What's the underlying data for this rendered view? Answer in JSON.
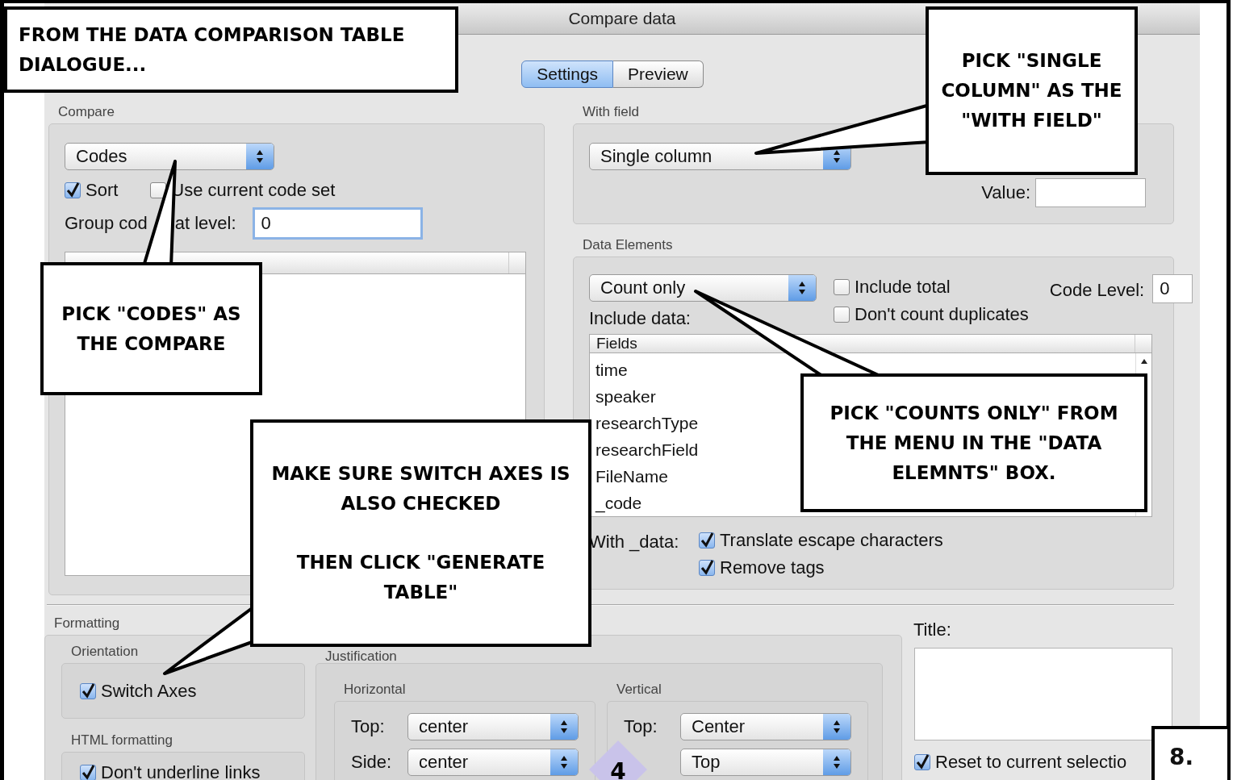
{
  "window": {
    "title": "Compare data"
  },
  "tabs": [
    {
      "label": "Settings",
      "selected": true
    },
    {
      "label": "Preview",
      "selected": false
    }
  ],
  "compare": {
    "title": "Compare",
    "menu": "Codes",
    "options": [
      {
        "label": "Sort",
        "checked": true
      },
      {
        "label": "Use current code set",
        "checked": false
      }
    ],
    "group_label_parts": [
      "Group cod",
      "at level:"
    ],
    "group_level": "0"
  },
  "with_field": {
    "title": "With field",
    "menu": "Single column",
    "value_label": "Value:"
  },
  "data_elements": {
    "title": "Data Elements",
    "menu": "Count only",
    "options": [
      {
        "label": "Include total",
        "checked": false
      },
      {
        "label": "Don't count duplicates",
        "checked": false
      }
    ],
    "code_level_label": "Code Level:",
    "code_level": "0",
    "include_label": "Include data:",
    "fields_header": "Fields",
    "fields": [
      "time",
      "speaker",
      "researchType",
      "researchField",
      "FileName",
      "_code"
    ],
    "with_data_label": "With _data:",
    "with_data_options": [
      {
        "label": "Translate escape characters",
        "checked": true
      },
      {
        "label": "Remove tags",
        "checked": true
      }
    ]
  },
  "formatting": {
    "title": "Formatting",
    "orientation": {
      "title": "Orientation",
      "option": {
        "label": "Switch Axes",
        "checked": true
      }
    },
    "html": {
      "title": "HTML formatting",
      "option": {
        "label": "Don't underline links",
        "checked": true
      }
    },
    "justification": {
      "title": "Justification",
      "horizontal": {
        "title": "Horizontal",
        "rows": [
          {
            "label": "Top:",
            "value": "center"
          },
          {
            "label": "Side:",
            "value": "center"
          }
        ]
      },
      "vertical": {
        "title": "Vertical",
        "rows": [
          {
            "label": "Top:",
            "value": "Center"
          },
          {
            "value": "Top"
          }
        ]
      }
    }
  },
  "title_field": {
    "label": "Title:",
    "reset": {
      "label": "Reset to current selectio",
      "checked": true
    }
  },
  "callouts": [
    {
      "paragraphs": [
        "FROM THE DATA COMPARISON TABLE DIALOGUE..."
      ]
    },
    {
      "paragraphs": [
        "PICK \"SINGLE COLUMN\" AS THE \"WITH FIELD\""
      ]
    },
    {
      "paragraphs": [
        "PICK \"CODES\" AS THE COMPARE"
      ]
    },
    {
      "paragraphs": [
        "MAKE SURE SWITCH AXES IS ALSO CHECKED",
        "THEN CLICK \"GENERATE TABLE\""
      ]
    },
    {
      "paragraphs": [
        "PICK \"COUNTS ONLY\" FROM THE MENU IN THE \"DATA ELEMNTS\" BOX."
      ]
    }
  ],
  "page_number": "8.",
  "corner_mark": "4"
}
